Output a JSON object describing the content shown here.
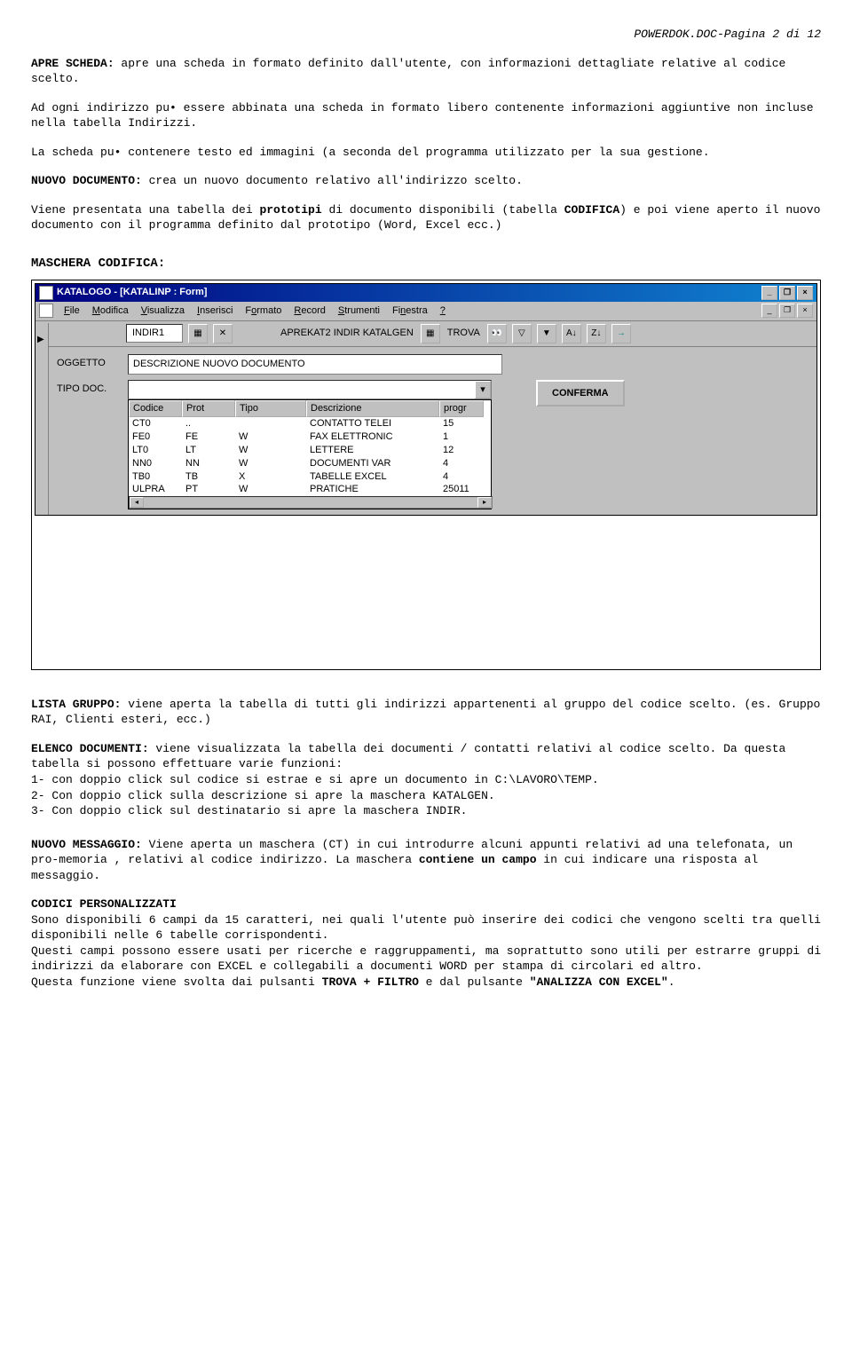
{
  "header": {
    "page_info": "POWERDOK.DOC-Pagina 2 di 12"
  },
  "para1": {
    "bold": "APRE SCHEDA:",
    "text": " apre una scheda in formato definito dall'utente, con informazioni dettagliate relative al codice scelto."
  },
  "para2": "Ad ogni indirizzo pu• essere abbinata una scheda in formato libero contenente informazioni aggiuntive non incluse nella tabella Indirizzi.",
  "para3": "La scheda pu• contenere testo ed immagini (a seconda del programma utilizzato per la sua gestione.",
  "para4": {
    "bold": "NUOVO DOCUMENTO:",
    "text": " crea un nuovo documento relativo all'indirizzo scelto."
  },
  "para5_a": "Viene presentata una tabella dei ",
  "para5_b": "prototipi",
  "para5_c": " di documento disponibili (tabella ",
  "para5_d": "CODIFICA",
  "para5_e": ") e poi viene aperto il nuovo documento con il programma definito dal prototipo (Word, Excel ecc.)",
  "section_codifica": "MASCHERA CODIFICA:",
  "app": {
    "title": "KATALOGO - [KATALINP : Form]",
    "menus": [
      "File",
      "Modifica",
      "Visualizza",
      "Inserisci",
      "Formato",
      "Record",
      "Strumenti",
      "Finestra",
      "?"
    ],
    "toolbar": {
      "field1": "INDIR1",
      "mid_labels": "APREKAT2  INDIR  KATALGEN",
      "trova": "TROVA"
    },
    "form": {
      "oggetto_label": "OGGETTO",
      "oggetto_value": "DESCRIZIONE NUOVO DOCUMENTO",
      "tipodoc_label": "TIPO DOC.",
      "conferma": "CONFERMA"
    },
    "dropdown": {
      "headers": [
        "Codice",
        "Prot",
        "Tipo",
        "Descrizione",
        "progr"
      ],
      "rows": [
        [
          "CT0",
          "..",
          "",
          "CONTATTO TELEI",
          "15"
        ],
        [
          "FE0",
          "FE",
          "W",
          "FAX ELETTRONIC",
          "1"
        ],
        [
          "LT0",
          "LT",
          "W",
          "LETTERE",
          "12"
        ],
        [
          "NN0",
          "NN",
          "W",
          "DOCUMENTI VAR",
          "4"
        ],
        [
          "TB0",
          "TB",
          "X",
          "TABELLE EXCEL",
          "4"
        ],
        [
          "ULPRA",
          "PT",
          "W",
          "PRATICHE",
          "25011"
        ]
      ]
    }
  },
  "lista_gruppo": {
    "bold": "LISTA GRUPPO:",
    "text": " viene aperta la tabella di tutti gli indirizzi appartenenti al gruppo del codice scelto. (es. Gruppo RAI, Clienti esteri, ecc.)"
  },
  "elenco_doc": {
    "bold": "ELENCO DOCUMENTI:",
    "text1": " viene visualizzata la tabella dei documenti / contatti relativi al codice scelto.  Da questa tabella si possono effettuare varie funzioni:",
    "li1": "1- con doppio click sul codice si estrae e si apre un documento in C:\\LAVORO\\TEMP.",
    "li2": "2- Con doppio click sulla descrizione si apre la maschera KATALGEN.",
    "li3": "3- Con doppio click sul destinatario si apre la maschera INDIR."
  },
  "nuovo_msg": {
    "bold": "NUOVO MESSAGGIO:",
    "a": " Viene aperta un maschera (CT) in cui introdurre alcuni appunti relativi ad una telefonata, un pro-memoria , relativi al codice indirizzo. La maschera ",
    "b": "contiene un campo",
    "c": "  in cui indicare una risposta al messaggio."
  },
  "codici": {
    "title": "CODICI PERSONALIZZATI",
    "p1": "Sono disponibili 6 campi da 15 caratteri, nei quali l'utente può inserire dei codici che vengono scelti tra quelli disponibili nelle 6 tabelle corrispondenti.",
    "p2": "Questi campi possono essere usati per ricerche e raggruppamenti, ma soprattutto sono utili per estrarre gruppi di indirizzi da elaborare con EXCEL e collegabili a documenti WORD per stampa di circolari ed altro.",
    "p3a": "Questa funzione viene svolta dai pulsanti ",
    "p3b": "TROVA + FILTRO",
    "p3c": " e dal pulsante ",
    "p3d": "\"ANALIZZA CON EXCEL\"",
    "p3e": "."
  }
}
